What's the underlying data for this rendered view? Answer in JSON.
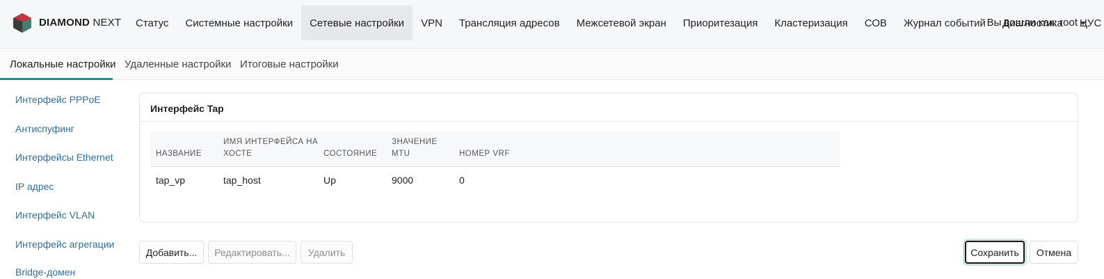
{
  "app": {
    "brand_bold": "DIAMOND",
    "brand_light": "NEXT",
    "logo_icon": "diamond-logo-icon"
  },
  "nav": {
    "items": [
      {
        "label": "Статус"
      },
      {
        "label": "Системные настройки"
      },
      {
        "label": "Сетевые настройки",
        "active": true
      },
      {
        "label": "VPN"
      },
      {
        "label": "Трансляция адресов"
      },
      {
        "label": "Межсетевой экран"
      },
      {
        "label": "Приоритезация"
      },
      {
        "label": "Кластеризация"
      },
      {
        "label": "СОВ"
      },
      {
        "label": "Журнал событий"
      },
      {
        "label": "Диагностика"
      },
      {
        "label": "ЦУС"
      }
    ],
    "user_label": "Вы вошли как: root"
  },
  "subtabs": {
    "items": [
      {
        "label": "Локальные настройки",
        "active": true
      },
      {
        "label": "Удаленные настройки"
      },
      {
        "label": "Итоговые настройки"
      }
    ],
    "accent_color": "#1f8f86"
  },
  "sidebar": {
    "items": [
      {
        "label": "Интерфейс PPPoE"
      },
      {
        "label": "Антиспуфинг"
      },
      {
        "label": "Интерфейсы Ethernet"
      },
      {
        "label": "IP адрес"
      },
      {
        "label": "Интерфейс VLAN"
      },
      {
        "label": "Интерфейс агрегации"
      },
      {
        "label": "Bridge-домен"
      }
    ],
    "link_color": "#2f6d9a"
  },
  "card": {
    "title": "Интерфейс Tap",
    "table": {
      "columns": [
        {
          "line1": "НАЗВАНИЕ",
          "line2": ""
        },
        {
          "line1": "ИМЯ ИНТЕРФЕЙСА НА",
          "line2": "ХОСТЕ"
        },
        {
          "line1": "СОСТОЯНИЕ",
          "line2": ""
        },
        {
          "line1": "ЗНАЧЕНИЕ",
          "line2": "MTU"
        },
        {
          "line1": "НОМЕР VRF",
          "line2": ""
        }
      ],
      "rows": [
        [
          "tap_vp",
          "tap_host",
          "Up",
          "9000",
          "0"
        ]
      ]
    }
  },
  "actions": {
    "add": "Добавить...",
    "edit": "Редактировать...",
    "delete": "Удалить",
    "save": "Сохранить",
    "cancel": "Отмена"
  }
}
